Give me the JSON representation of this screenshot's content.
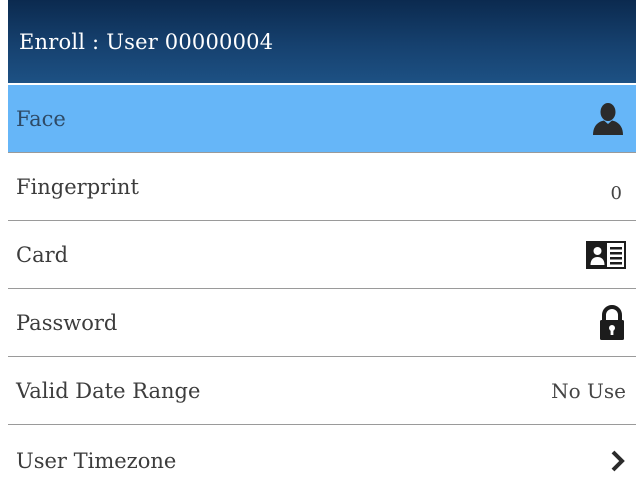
{
  "header": {
    "title": "Enroll :  User 00000004"
  },
  "menu": {
    "items": [
      {
        "label": "Face",
        "icon": "user-silhouette-icon",
        "selected": true
      },
      {
        "label": "Fingerprint",
        "value": "0"
      },
      {
        "label": "Card",
        "icon": "id-card-icon"
      },
      {
        "label": "Password",
        "icon": "lock-icon"
      },
      {
        "label": "Valid Date Range",
        "value": "No Use"
      },
      {
        "label": "User Timezone",
        "icon": "chevron-right-icon"
      }
    ]
  },
  "colors": {
    "header_dark": "#0b2a4f",
    "header_light": "#1d5184",
    "selected_row": "#66b6f8",
    "divider": "#9a9a9a"
  }
}
